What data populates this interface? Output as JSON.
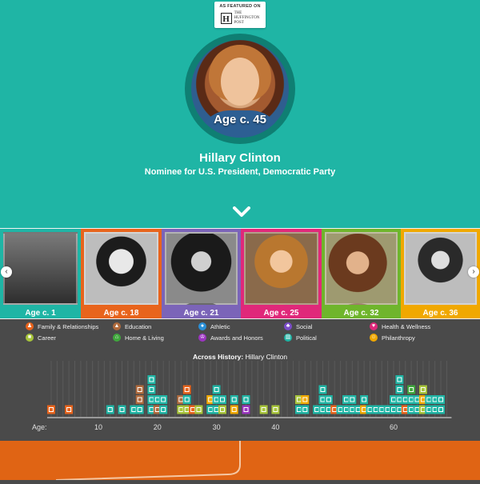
{
  "badge": {
    "featured": "AS FEATURED ON",
    "logo_letter": "H",
    "logo_line1": "THE",
    "logo_line2": "HUFFINGTON",
    "logo_line3": "POST"
  },
  "hero": {
    "age": "Age c. 45",
    "name": "Hillary Clinton",
    "subtitle": "Nominee for U.S. President, Democratic Party"
  },
  "cards": [
    {
      "label": "Age c. 1",
      "color": "#1fb5a5"
    },
    {
      "label": "Age c. 18",
      "color": "#e8641c"
    },
    {
      "label": "Age c. 21",
      "color": "#7b64b8"
    },
    {
      "label": "Age c. 25",
      "color": "#e0287a"
    },
    {
      "label": "Age c. 32",
      "color": "#6fb52c"
    },
    {
      "label": "Age c. 36",
      "color": "#f0a800"
    }
  ],
  "nav": {
    "prev_icon": "chevron-left-icon",
    "next_icon": "chevron-right-icon"
  },
  "legend": [
    {
      "label": "Family & Relationships",
      "color": "#e8641c",
      "icon": "person-icon"
    },
    {
      "label": "Education",
      "color": "#b06a3c",
      "icon": "graduation-cap-icon"
    },
    {
      "label": "Athletic",
      "color": "#2a8fd8",
      "icon": "ball-icon"
    },
    {
      "label": "Social",
      "color": "#7b4cc8",
      "icon": "group-icon"
    },
    {
      "label": "Health & Wellness",
      "color": "#e0287a",
      "icon": "heart-icon"
    },
    {
      "label": "Career",
      "color": "#a7c43a",
      "icon": "briefcase-icon"
    },
    {
      "label": "Home & Living",
      "color": "#3fa83c",
      "icon": "house-icon"
    },
    {
      "label": "Awards and Honors",
      "color": "#9b34c0",
      "icon": "trophy-icon"
    },
    {
      "label": "Political",
      "color": "#1fb5a5",
      "icon": "capitol-icon"
    },
    {
      "label": "Philanthropy",
      "color": "#f0a800",
      "icon": "smiley-icon"
    }
  ],
  "timeline": {
    "title_prefix": "Across History:",
    "title_name": "Hillary Clinton",
    "axis_label": "Age:",
    "ticks": [
      "10",
      "20",
      "30",
      "40",
      "60"
    ],
    "tick_ages": [
      10,
      20,
      30,
      40,
      60
    ],
    "age_range": [
      2,
      69
    ],
    "events": [
      {
        "age": 2,
        "cats": [
          "Family & Relationships"
        ]
      },
      {
        "age": 5,
        "cats": [
          "Family & Relationships"
        ]
      },
      {
        "age": 12,
        "cats": [
          "Political"
        ]
      },
      {
        "age": 14,
        "cats": [
          "Political"
        ]
      },
      {
        "age": 16,
        "cats": [
          "Political"
        ]
      },
      {
        "age": 17,
        "cats": [
          "Political",
          "Education",
          "Education"
        ]
      },
      {
        "age": 19,
        "cats": [
          "Political",
          "Political",
          "Political",
          "Political"
        ]
      },
      {
        "age": 20,
        "cats": [
          "Education",
          "Political"
        ]
      },
      {
        "age": 21,
        "cats": [
          "Political",
          "Political"
        ]
      },
      {
        "age": 24,
        "cats": [
          "Career",
          "Education"
        ]
      },
      {
        "age": 25,
        "cats": [
          "Career",
          "Political",
          "Family & Relationships"
        ]
      },
      {
        "age": 26,
        "cats": [
          "Family & Relationships"
        ]
      },
      {
        "age": 27,
        "cats": [
          "Career"
        ]
      },
      {
        "age": 29,
        "cats": [
          "Political",
          "Philanthropy"
        ]
      },
      {
        "age": 30,
        "cats": [
          "Political",
          "Political",
          "Political"
        ]
      },
      {
        "age": 31,
        "cats": [
          "Career",
          "Political"
        ]
      },
      {
        "age": 33,
        "cats": [
          "Philanthropy",
          "Political"
        ]
      },
      {
        "age": 35,
        "cats": [
          "Awards and Honors",
          "Political"
        ]
      },
      {
        "age": 38,
        "cats": [
          "Career"
        ]
      },
      {
        "age": 40,
        "cats": [
          "Career"
        ]
      },
      {
        "age": 44,
        "cats": [
          "Political",
          "Career"
        ]
      },
      {
        "age": 45,
        "cats": [
          "Political",
          "Philanthropy"
        ]
      },
      {
        "age": 47,
        "cats": [
          "Political"
        ]
      },
      {
        "age": 48,
        "cats": [
          "Political",
          "Political",
          "Political"
        ]
      },
      {
        "age": 49,
        "cats": [
          "Political",
          "Political"
        ]
      },
      {
        "age": 50,
        "cats": [
          "Family & Relationships"
        ]
      },
      {
        "age": 51,
        "cats": [
          "Political"
        ]
      },
      {
        "age": 52,
        "cats": [
          "Political",
          "Political"
        ]
      },
      {
        "age": 53,
        "cats": [
          "Political",
          "Political"
        ]
      },
      {
        "age": 54,
        "cats": [
          "Political"
        ]
      },
      {
        "age": 55,
        "cats": [
          "Philanthropy",
          "Political"
        ]
      },
      {
        "age": 56,
        "cats": [
          "Political"
        ]
      },
      {
        "age": 57,
        "cats": [
          "Political"
        ]
      },
      {
        "age": 58,
        "cats": [
          "Political"
        ]
      },
      {
        "age": 59,
        "cats": [
          "Political"
        ]
      },
      {
        "age": 60,
        "cats": [
          "Political",
          "Political"
        ]
      },
      {
        "age": 61,
        "cats": [
          "Political",
          "Political",
          "Political",
          "Political"
        ]
      },
      {
        "age": 62,
        "cats": [
          "Family & Relationships",
          "Political"
        ]
      },
      {
        "age": 63,
        "cats": [
          "Political",
          "Political",
          "Home & Living"
        ]
      },
      {
        "age": 64,
        "cats": [
          "Political",
          "Political"
        ]
      },
      {
        "age": 65,
        "cats": [
          "Career",
          "Philanthropy",
          "Career"
        ]
      },
      {
        "age": 66,
        "cats": [
          "Political",
          "Political"
        ]
      },
      {
        "age": 67,
        "cats": [
          "Political",
          "Political"
        ]
      },
      {
        "age": 68,
        "cats": [
          "Political",
          "Political"
        ]
      }
    ]
  }
}
